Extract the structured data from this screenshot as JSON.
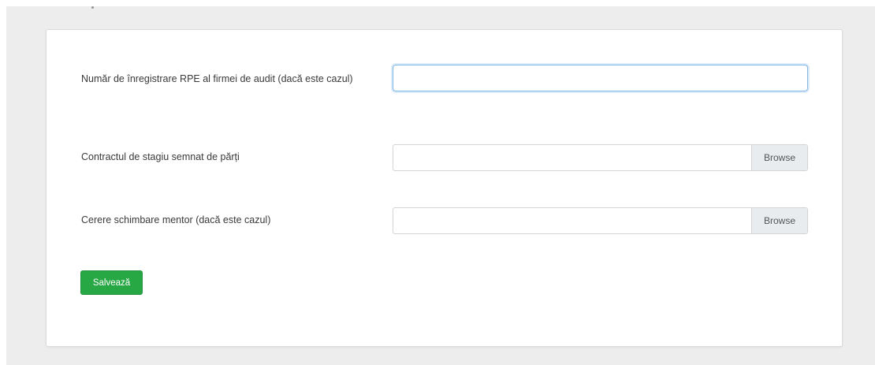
{
  "form": {
    "fields": [
      {
        "label": "Număr de înregistrare RPE al firmei de audit (dacă este cazul)",
        "type": "text",
        "value": ""
      },
      {
        "label": "Contractul de stagiu semnat de părți",
        "type": "file",
        "browse_label": "Browse"
      },
      {
        "label": "Cerere schimbare mentor (dacă este cazul)",
        "type": "file",
        "browse_label": "Browse"
      }
    ],
    "save_label": "Salvează"
  },
  "colors": {
    "page_background": "#ededed",
    "card_background": "#ffffff",
    "focus_border": "#80b6e6",
    "save_button": "#28a745",
    "browse_background": "#e9ecef"
  }
}
